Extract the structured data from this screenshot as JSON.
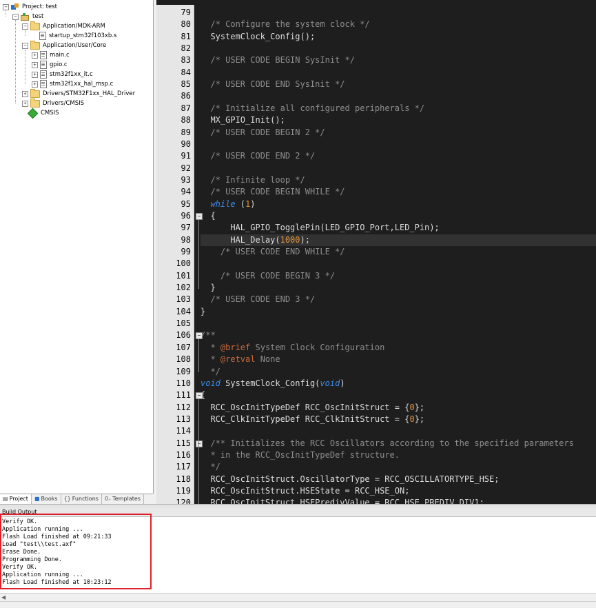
{
  "project_tree": {
    "root": "Project: test",
    "target": "test",
    "groups": [
      {
        "label": "Application/MDK-ARM",
        "files": [
          "startup_stm32f103xb.s"
        ]
      },
      {
        "label": "Application/User/Core",
        "files": [
          "main.c",
          "gpio.c",
          "stm32f1xx_it.c",
          "stm32f1xx_hal_msp.c"
        ]
      },
      {
        "label": "Drivers/STM32F1xx_HAL_Driver"
      },
      {
        "label": "Drivers/CMSIS"
      },
      {
        "label": "CMSIS"
      }
    ]
  },
  "panel_tabs": [
    {
      "label": "Project",
      "icon": "project-tab-icon"
    },
    {
      "label": "Books",
      "icon": "books-icon"
    },
    {
      "label": "Functions",
      "icon": "functions-icon"
    },
    {
      "label": "Templates",
      "icon": "templates-icon"
    }
  ],
  "editor": {
    "lines": [
      {
        "n": "79",
        "text": ""
      },
      {
        "n": "80",
        "text": "  /* Configure the system clock */"
      },
      {
        "n": "81",
        "text": "  SystemClock_Config();"
      },
      {
        "n": "82",
        "text": ""
      },
      {
        "n": "83",
        "text": "  /* USER CODE BEGIN SysInit */"
      },
      {
        "n": "84",
        "text": ""
      },
      {
        "n": "85",
        "text": "  /* USER CODE END SysInit */"
      },
      {
        "n": "86",
        "text": ""
      },
      {
        "n": "87",
        "text": "  /* Initialize all configured peripherals */"
      },
      {
        "n": "88",
        "text": "  MX_GPIO_Init();"
      },
      {
        "n": "89",
        "text": "  /* USER CODE BEGIN 2 */"
      },
      {
        "n": "90",
        "text": ""
      },
      {
        "n": "91",
        "text": "  /* USER CODE END 2 */"
      },
      {
        "n": "92",
        "text": ""
      },
      {
        "n": "93",
        "text": "  /* Infinite loop */"
      },
      {
        "n": "94",
        "text": "  /* USER CODE BEGIN WHILE */"
      },
      {
        "n": "95",
        "text": "  while (1)"
      },
      {
        "n": "96",
        "text": "  {"
      },
      {
        "n": "97",
        "text": "      HAL_GPIO_TogglePin(LED_GPIO_Port,LED_Pin);"
      },
      {
        "n": "98",
        "text": "      HAL_Delay(1000);"
      },
      {
        "n": "99",
        "text": "    /* USER CODE END WHILE */"
      },
      {
        "n": "100",
        "text": ""
      },
      {
        "n": "101",
        "text": "    /* USER CODE BEGIN 3 */"
      },
      {
        "n": "102",
        "text": "  }"
      },
      {
        "n": "103",
        "text": "  /* USER CODE END 3 */"
      },
      {
        "n": "104",
        "text": "}"
      },
      {
        "n": "105",
        "text": ""
      },
      {
        "n": "106",
        "text": "/**"
      },
      {
        "n": "107",
        "text": "  * @brief System Clock Configuration"
      },
      {
        "n": "108",
        "text": "  * @retval None"
      },
      {
        "n": "109",
        "text": "  */"
      },
      {
        "n": "110",
        "text": "void SystemClock_Config(void)"
      },
      {
        "n": "111",
        "text": "{"
      },
      {
        "n": "112",
        "text": "  RCC_OscInitTypeDef RCC_OscInitStruct = {0};"
      },
      {
        "n": "113",
        "text": "  RCC_ClkInitTypeDef RCC_ClkInitStruct = {0};"
      },
      {
        "n": "114",
        "text": ""
      },
      {
        "n": "115",
        "text": "  /** Initializes the RCC Oscillators according to the specified parameters"
      },
      {
        "n": "116",
        "text": "  * in the RCC_OscInitTypeDef structure."
      },
      {
        "n": "117",
        "text": "  */"
      },
      {
        "n": "118",
        "text": "  RCC_OscInitStruct.OscillatorType = RCC_OSCILLATORTYPE_HSE;"
      },
      {
        "n": "119",
        "text": "  RCC_OscInitStruct.HSEState = RCC_HSE_ON;"
      },
      {
        "n": "120",
        "text": "  RCC_OscInitStruct.HSEPredivValue = RCC_HSE_PREDIV_DIV1;"
      }
    ]
  },
  "build_output": {
    "title": "Build Output",
    "lines": [
      "Verify OK.",
      "Application running ...",
      "Flash Load finished at 09:21:33",
      "Load \"test\\\\test.axf\"",
      "Erase Done.",
      "Programming Done.",
      "Verify OK.",
      "Application running ...",
      "Flash Load finished at 10:23:12"
    ]
  },
  "colors": {
    "editor_bg": "#1e1e1e",
    "comment": "#8e8e8e",
    "keyword": "#3c8ce6",
    "number": "#e3963e",
    "highlight_box": "#e0202a"
  }
}
